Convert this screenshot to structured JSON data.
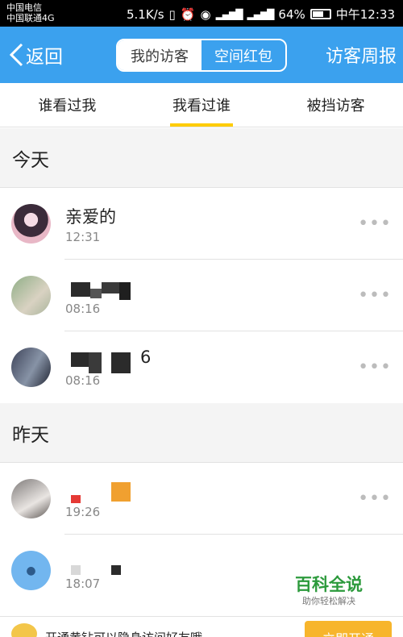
{
  "status_bar": {
    "carrier_1": "中国电信",
    "carrier_2": "中国联通4G",
    "net_speed": "5.1K/s",
    "battery": "64%",
    "time": "中午12:33"
  },
  "header": {
    "back_label": "返回",
    "segments": [
      "我的访客",
      "空间红包"
    ],
    "active_segment": "我的访客",
    "weekly_label": "访客周报",
    "accent_color": "#3ba1ee"
  },
  "tabs": [
    "谁看过我",
    "我看过谁",
    "被挡访客"
  ],
  "selected_tab": "我看过谁",
  "tab_indicator_color": "#ffcc00",
  "sections": {
    "today": {
      "title": "今天",
      "items": [
        {
          "name": "亲爱的",
          "time": "12:31",
          "more": "•••"
        },
        {
          "name": "",
          "time": "08:16",
          "more": "•••"
        },
        {
          "name": "6",
          "time": "08:16",
          "more": "•••"
        }
      ]
    },
    "yesterday": {
      "title": "昨天",
      "items": [
        {
          "name": "",
          "time": "19:26",
          "more": "•••"
        },
        {
          "name": "",
          "time": "18:07",
          "more": ""
        }
      ]
    }
  },
  "bottom_banner": {
    "text": "开通黄钻可以隐身访问好友哦",
    "button": "立即开通"
  },
  "watermark": {
    "title": "百科全说",
    "subtitle": "助你轻松解决"
  }
}
